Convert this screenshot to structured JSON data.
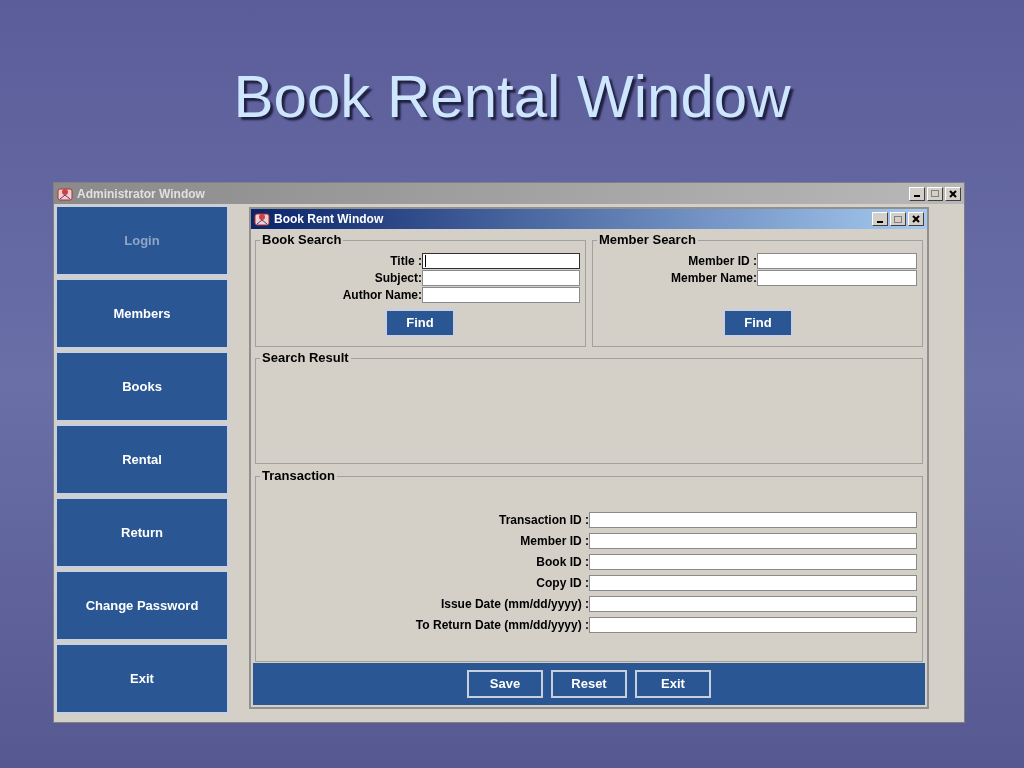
{
  "slide": {
    "title": "Book Rental Window"
  },
  "admin_window": {
    "title": "Administrator Window"
  },
  "sidebar": {
    "items": [
      {
        "label": "Login",
        "disabled": true
      },
      {
        "label": "Members",
        "disabled": false
      },
      {
        "label": "Books",
        "disabled": false
      },
      {
        "label": "Rental",
        "disabled": false
      },
      {
        "label": "Return",
        "disabled": false
      },
      {
        "label": "Change Password",
        "disabled": false
      },
      {
        "label": "Exit",
        "disabled": false
      }
    ]
  },
  "rent_window": {
    "title": "Book Rent Window",
    "book_search": {
      "title": "Book Search",
      "fields": [
        {
          "label": "Title :",
          "focused": true
        },
        {
          "label": "Subject:",
          "focused": false
        },
        {
          "label": "Author Name:",
          "focused": false
        }
      ],
      "button": "Find"
    },
    "member_search": {
      "title": "Member Search",
      "fields": [
        {
          "label": "Member ID :",
          "focused": false
        },
        {
          "label": "Member Name:",
          "focused": false
        }
      ],
      "button": "Find"
    },
    "search_result": {
      "title": "Search Result"
    },
    "transaction": {
      "title": "Transaction",
      "fields": [
        {
          "label": "Transaction ID :"
        },
        {
          "label": "Member ID :"
        },
        {
          "label": "Book ID :"
        },
        {
          "label": "Copy ID :"
        },
        {
          "label": "Issue Date (mm/dd/yyyy) :"
        },
        {
          "label": "To Return Date (mm/dd/yyyy) :"
        }
      ]
    },
    "buttons": [
      "Save",
      "Reset",
      "Exit"
    ]
  }
}
